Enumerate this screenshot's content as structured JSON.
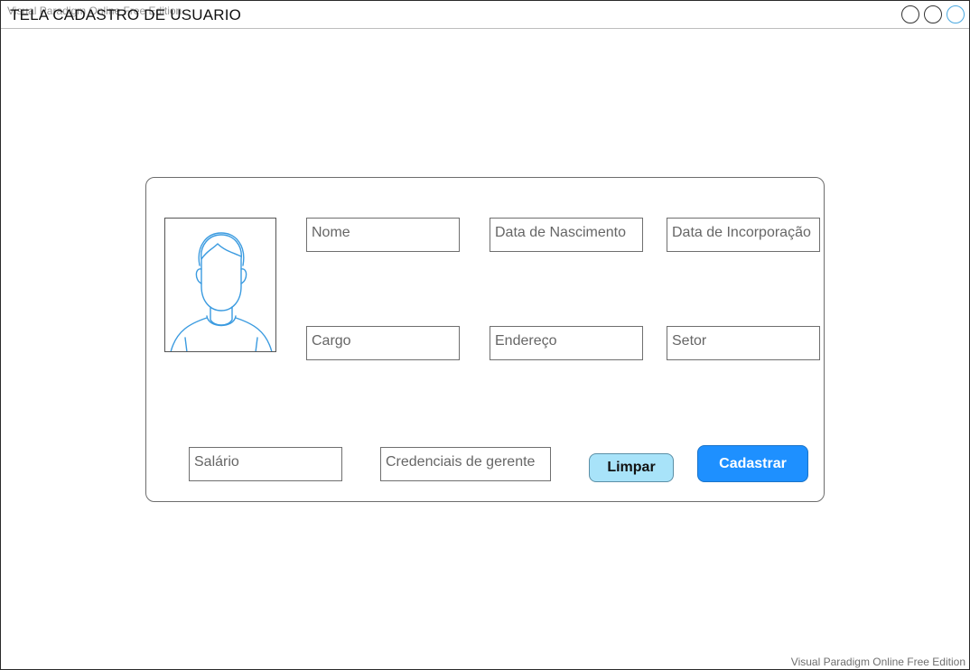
{
  "window": {
    "title": "TELA CADASTRO DE USUARIO",
    "watermark_top": "Visual Paradigm Online Free Edition",
    "watermark_bottom": "Visual Paradigm Online Free Edition"
  },
  "form": {
    "fields": {
      "nome": "Nome",
      "data_nascimento": "Data de Nascimento",
      "data_incorporacao": "Data de Incorporação",
      "cargo": "Cargo",
      "endereco": "Endereço",
      "setor": "Setor",
      "salario": "Salário",
      "credenciais": "Credenciais de gerente"
    },
    "buttons": {
      "limpar": "Limpar",
      "cadastrar": "Cadastrar"
    }
  },
  "icons": {
    "avatar": "user-avatar-icon",
    "window_controls": [
      "circle-icon",
      "circle-icon",
      "circle-icon"
    ]
  },
  "colors": {
    "avatar_stroke": "#3b9be0",
    "limpar_bg": "#a8e3f9",
    "cadastrar_bg": "#1e90ff"
  }
}
